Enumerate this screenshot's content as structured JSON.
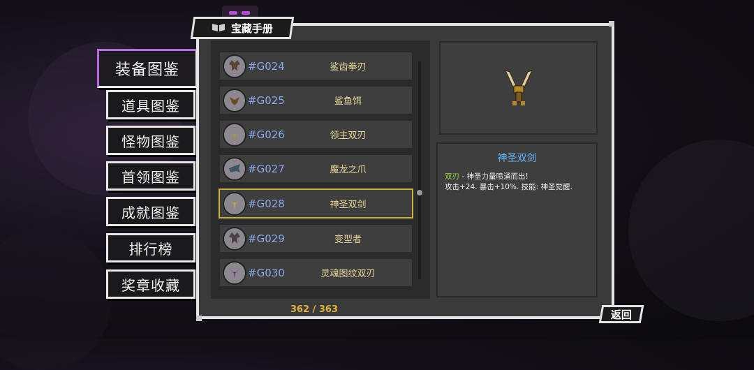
{
  "title": "宝藏手册",
  "nav": [
    {
      "label": "装备图鉴",
      "active": true
    },
    {
      "label": "道具图鉴",
      "active": false
    },
    {
      "label": "怪物图鉴",
      "active": false
    },
    {
      "label": "首领图鉴",
      "active": false
    },
    {
      "label": "成就图鉴",
      "active": false
    },
    {
      "label": "排行榜",
      "active": false
    },
    {
      "label": "奖章收藏",
      "active": false
    }
  ],
  "list": [
    {
      "id": "#G024",
      "name": "鲨齿拳刃",
      "icon": "bat-icon"
    },
    {
      "id": "#G025",
      "name": "鲨鱼饵",
      "icon": "bird-icon"
    },
    {
      "id": "#G026",
      "name": "领主双刃",
      "icon": "twin-blade-icon"
    },
    {
      "id": "#G027",
      "name": "魔龙之爪",
      "icon": "claw-icon"
    },
    {
      "id": "#G028",
      "name": "神圣双剑",
      "icon": "twin-blade-icon",
      "selected": true
    },
    {
      "id": "#G029",
      "name": "变型者",
      "icon": "bat-icon"
    },
    {
      "id": "#G030",
      "name": "灵魂图纹双刃",
      "icon": "twin-blade-icon"
    }
  ],
  "counter": "362 / 363",
  "detail": {
    "name": "神圣双剑",
    "tag": "双刃",
    "line1": " - 神圣力量喷涌而出!",
    "line2": "攻击+24. 暴击+10%. 技能: 神圣觉醒."
  },
  "back_label": "返回"
}
